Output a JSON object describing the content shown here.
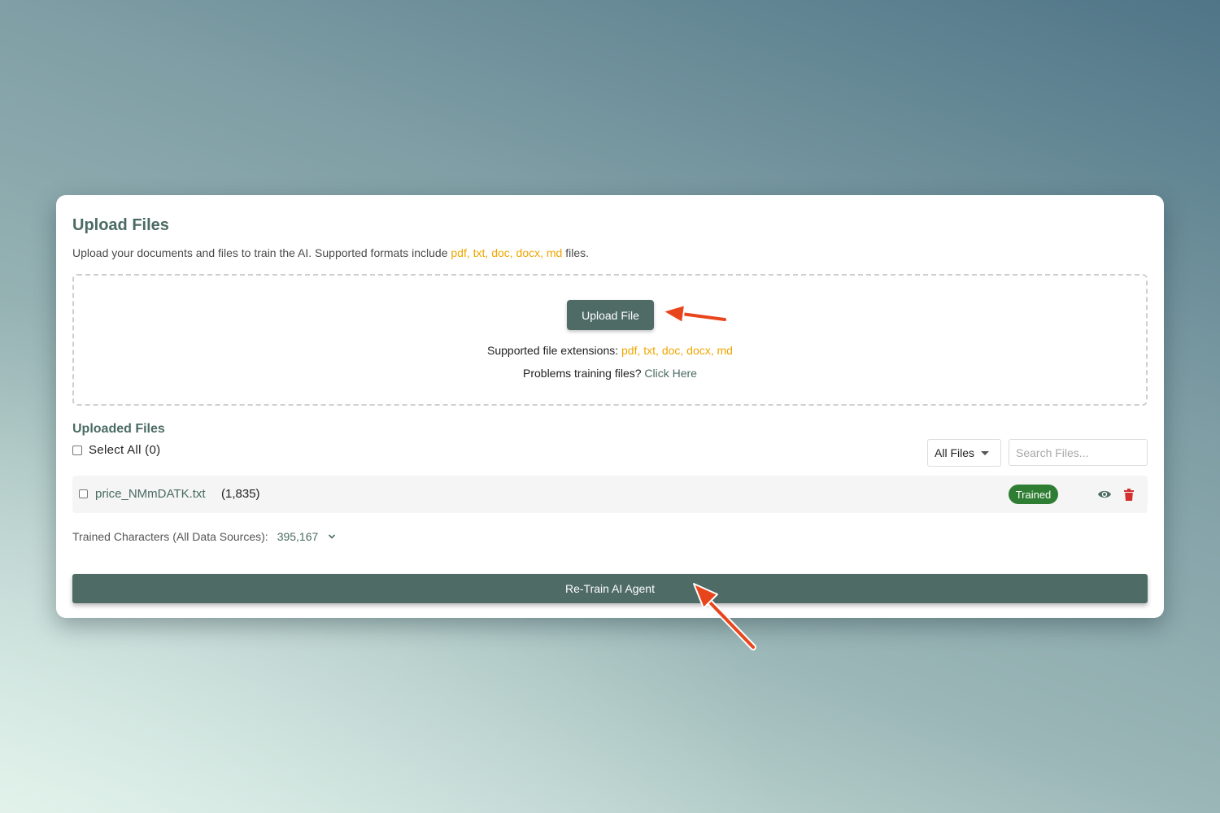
{
  "card": {
    "title": "Upload Files",
    "description_prefix": "Upload your documents and files to train the AI. Supported formats include ",
    "description_formats": "pdf, txt, doc, docx, md",
    "description_suffix": " files."
  },
  "dropzone": {
    "upload_button_label": "Upload File",
    "extensions_prefix": "Supported file extensions: ",
    "extensions_list": "pdf, txt, doc, docx, md",
    "help_prefix": "Problems training files? ",
    "help_link": "Click Here"
  },
  "uploaded": {
    "section_title": "Uploaded Files",
    "select_all_label": "Select All (0)",
    "filter_selected": "All Files",
    "search_placeholder": "Search Files...",
    "files": [
      {
        "name": "price_NMmDATK.txt",
        "count": "(1,835)",
        "status": "Trained"
      }
    ]
  },
  "summary": {
    "label": "Trained Characters (All Data Sources):",
    "value": "395,167"
  },
  "actions": {
    "retrain_label": "Re-Train AI Agent"
  },
  "icons": {
    "view": "eye-icon",
    "delete": "trash-icon",
    "expand": "chevron-down-icon",
    "filter_caret": "caret-down-icon",
    "annotation": "arrow-pointer-icon"
  },
  "colors": {
    "primary": "#4f6b65",
    "accent": "#f0a500",
    "badge_success": "#2e7d32",
    "delete_red": "#d32f2f",
    "annotation_arrow": "#e8451c"
  }
}
